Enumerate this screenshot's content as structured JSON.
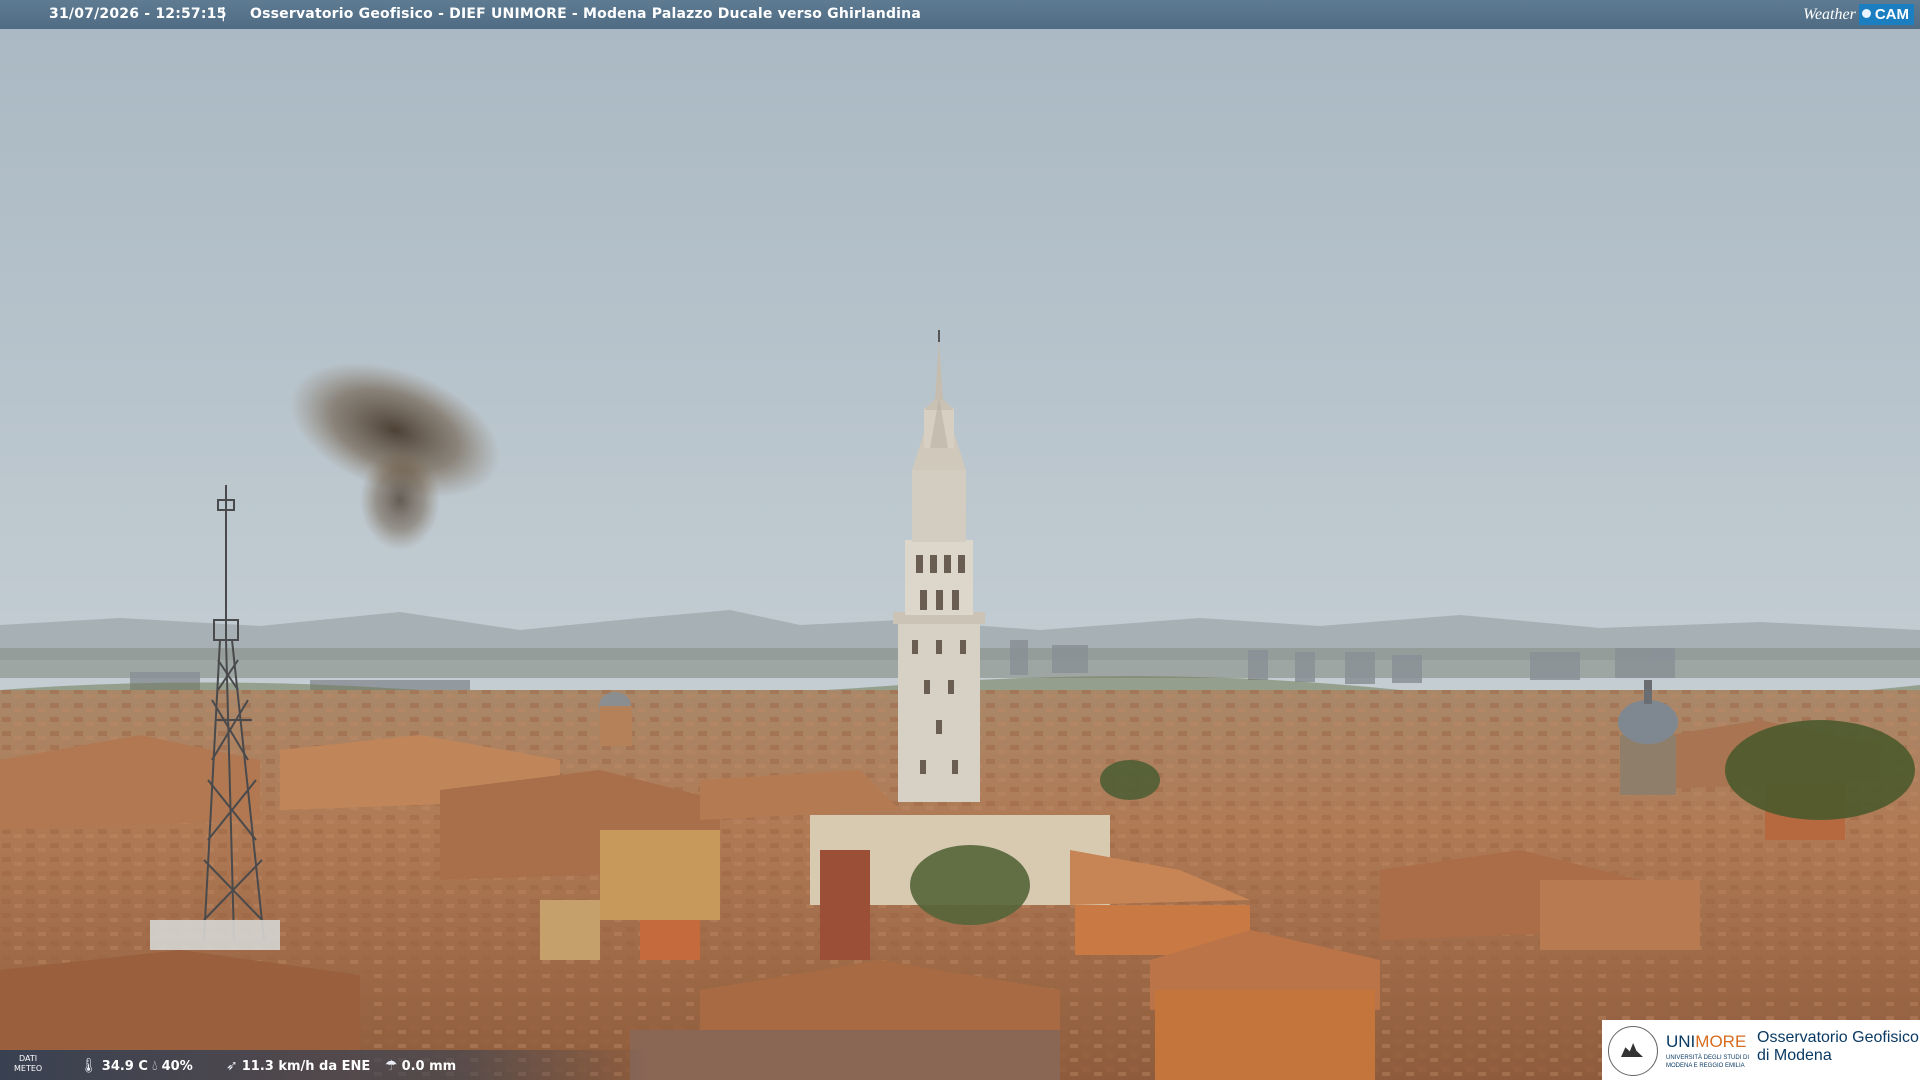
{
  "header": {
    "timestamp": "31/07/2026 - 12:57:15",
    "separator": "|",
    "title": "Osservatorio Geofisico - DIEF UNIMORE - Modena Palazzo Ducale verso Ghirlandina"
  },
  "brand": {
    "weather": "Weather",
    "cam": "CAM"
  },
  "meteo": {
    "label_line1": "DATI",
    "label_line2": "METEO",
    "temperature": "34.9 C",
    "humidity": "40%",
    "wind": "11.3 km/h da ENE",
    "rain": "0.0 mm"
  },
  "logo": {
    "uni": "UNI",
    "more": "MORE",
    "uni_sub_1": "UNIVERSITÀ DEGLI STUDI DI",
    "uni_sub_2": "MODENA E REGGIO EMILIA",
    "observatory_line1": "Osservatorio Geofisico",
    "observatory_line2": "di Modena"
  },
  "icons": {
    "temperature": "thermometer-icon",
    "humidity": "droplet-icon",
    "wind": "wind-icon",
    "rain": "rain-icon"
  }
}
